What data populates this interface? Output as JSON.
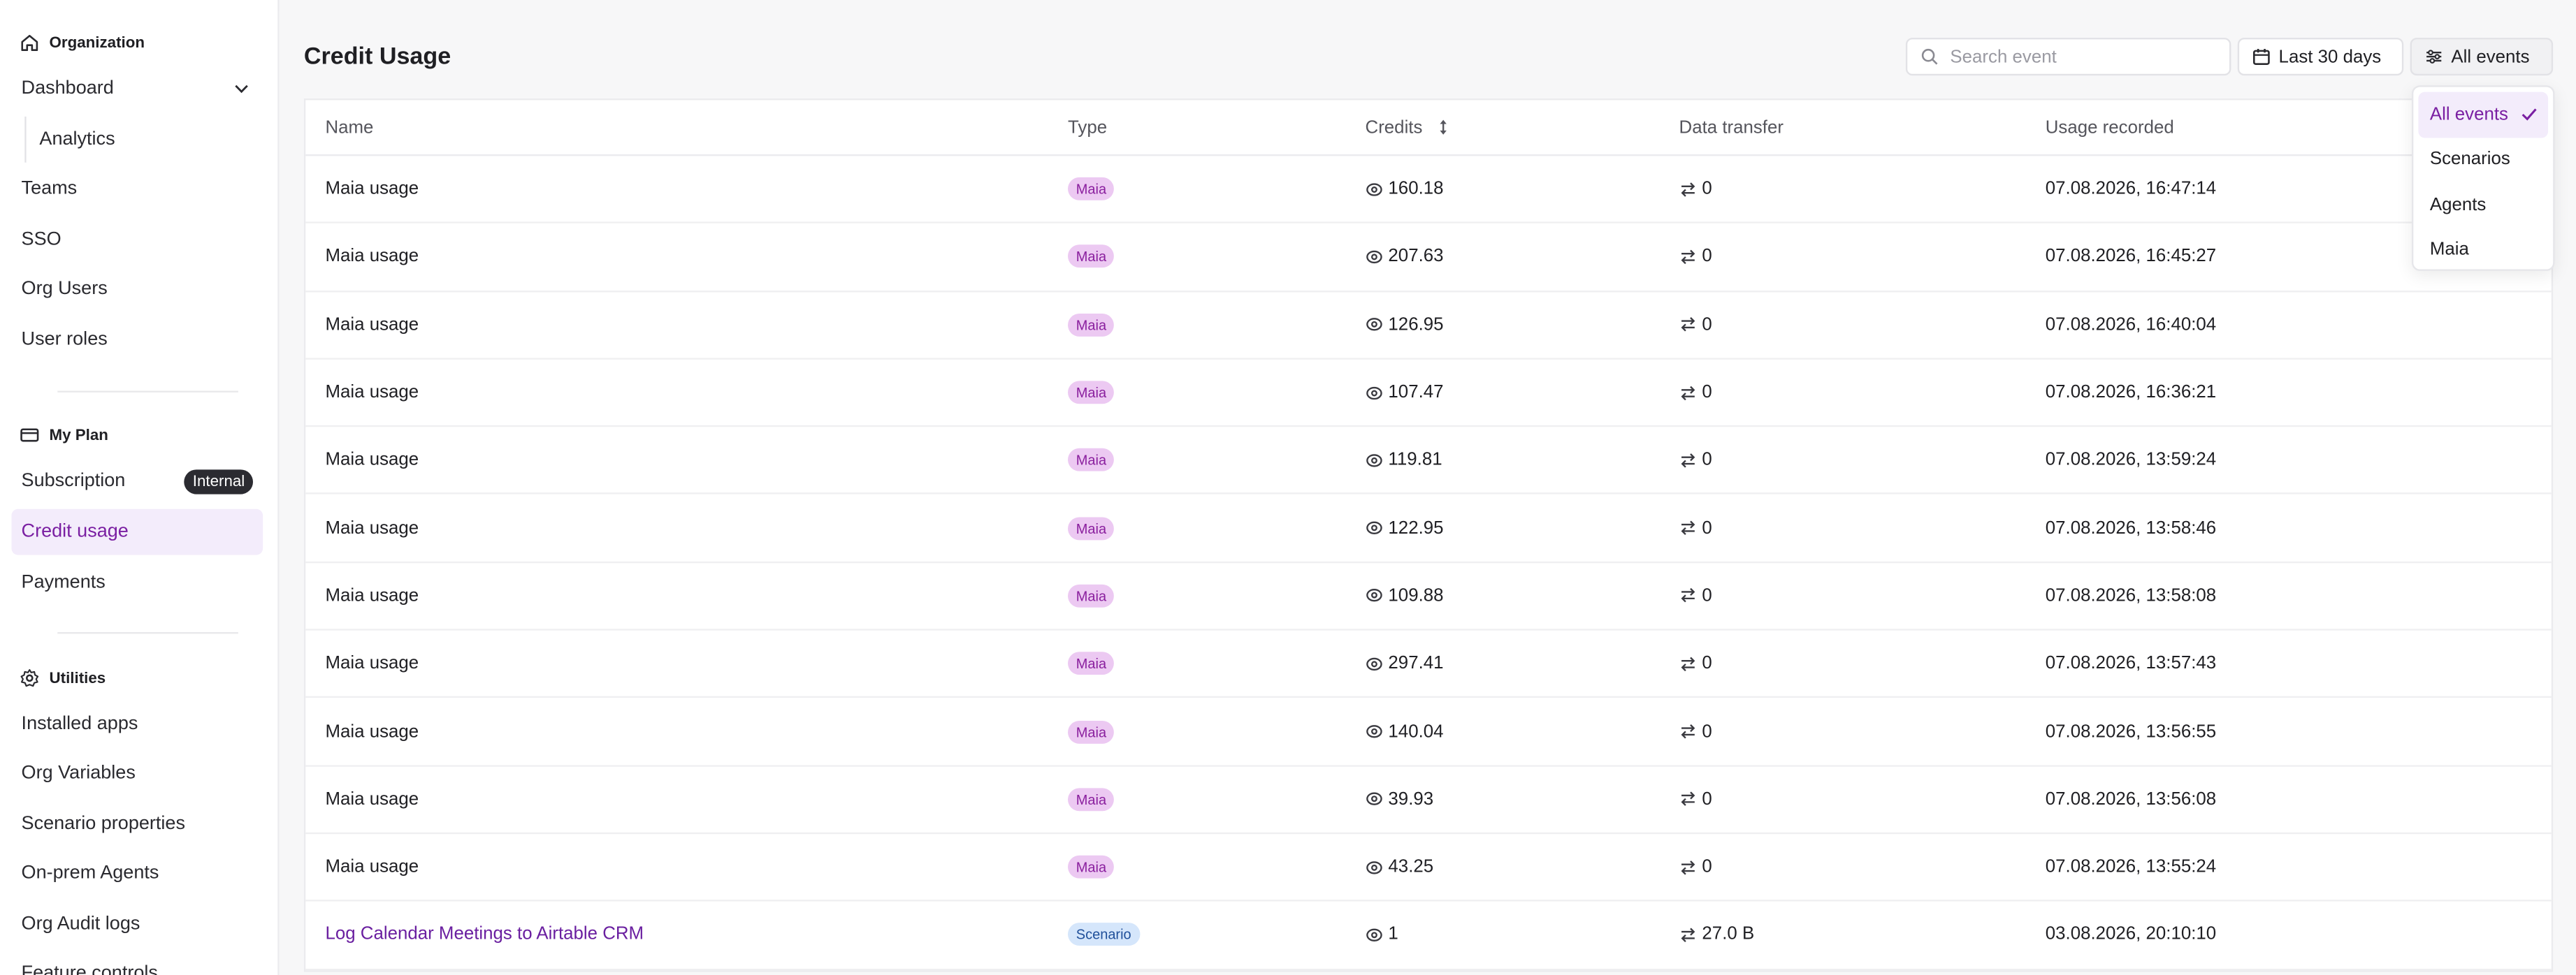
{
  "sidebar": {
    "organization_heading": "Organization",
    "org_items": [
      {
        "label": "Dashboard"
      },
      {
        "label": "Analytics"
      },
      {
        "label": "Teams"
      },
      {
        "label": "SSO"
      },
      {
        "label": "Org Users"
      },
      {
        "label": "User roles"
      }
    ],
    "plan_heading": "My Plan",
    "plan_items": [
      {
        "label": "Subscription",
        "badge": "Internal"
      },
      {
        "label": "Credit usage"
      },
      {
        "label": "Payments"
      }
    ],
    "utilities_heading": "Utilities",
    "utility_items": [
      {
        "label": "Installed apps"
      },
      {
        "label": "Org Variables"
      },
      {
        "label": "Scenario properties"
      },
      {
        "label": "On-prem Agents"
      },
      {
        "label": "Org Audit logs"
      },
      {
        "label": "Feature controls"
      }
    ]
  },
  "header": {
    "title": "Credit Usage",
    "search_placeholder": "Search event",
    "date_range": "Last 30 days",
    "filter": "All events"
  },
  "table": {
    "columns": [
      "Name",
      "Type",
      "Credits",
      "Data transfer",
      "Usage recorded"
    ],
    "rows": [
      {
        "name": "Maia usage",
        "type": "Maia",
        "credits": "160.18",
        "transfer": "0",
        "recorded": "07.08.2026, 16:47:14"
      },
      {
        "name": "Maia usage",
        "type": "Maia",
        "credits": "207.63",
        "transfer": "0",
        "recorded": "07.08.2026, 16:45:27"
      },
      {
        "name": "Maia usage",
        "type": "Maia",
        "credits": "126.95",
        "transfer": "0",
        "recorded": "07.08.2026, 16:40:04"
      },
      {
        "name": "Maia usage",
        "type": "Maia",
        "credits": "107.47",
        "transfer": "0",
        "recorded": "07.08.2026, 16:36:21"
      },
      {
        "name": "Maia usage",
        "type": "Maia",
        "credits": "119.81",
        "transfer": "0",
        "recorded": "07.08.2026, 13:59:24"
      },
      {
        "name": "Maia usage",
        "type": "Maia",
        "credits": "122.95",
        "transfer": "0",
        "recorded": "07.08.2026, 13:58:46"
      },
      {
        "name": "Maia usage",
        "type": "Maia",
        "credits": "109.88",
        "transfer": "0",
        "recorded": "07.08.2026, 13:58:08"
      },
      {
        "name": "Maia usage",
        "type": "Maia",
        "credits": "297.41",
        "transfer": "0",
        "recorded": "07.08.2026, 13:57:43"
      },
      {
        "name": "Maia usage",
        "type": "Maia",
        "credits": "140.04",
        "transfer": "0",
        "recorded": "07.08.2026, 13:56:55"
      },
      {
        "name": "Maia usage",
        "type": "Maia",
        "credits": "39.93",
        "transfer": "0",
        "recorded": "07.08.2026, 13:56:08"
      },
      {
        "name": "Maia usage",
        "type": "Maia",
        "credits": "43.25",
        "transfer": "0",
        "recorded": "07.08.2026, 13:55:24"
      },
      {
        "name": "Log Calendar Meetings to Airtable CRM",
        "type": "Scenario",
        "credits": "1",
        "transfer": "27.0 B",
        "recorded": "03.08.2026, 20:10:10"
      }
    ]
  },
  "filter_menu": {
    "options": [
      "All events",
      "Scenarios",
      "Agents",
      "Maia"
    ],
    "selected": "All events"
  },
  "colors": {
    "accent": "#7a1fa2",
    "maia_tag_bg": "#ecc9f2",
    "scenario_tag_bg": "#d5e6fb"
  }
}
